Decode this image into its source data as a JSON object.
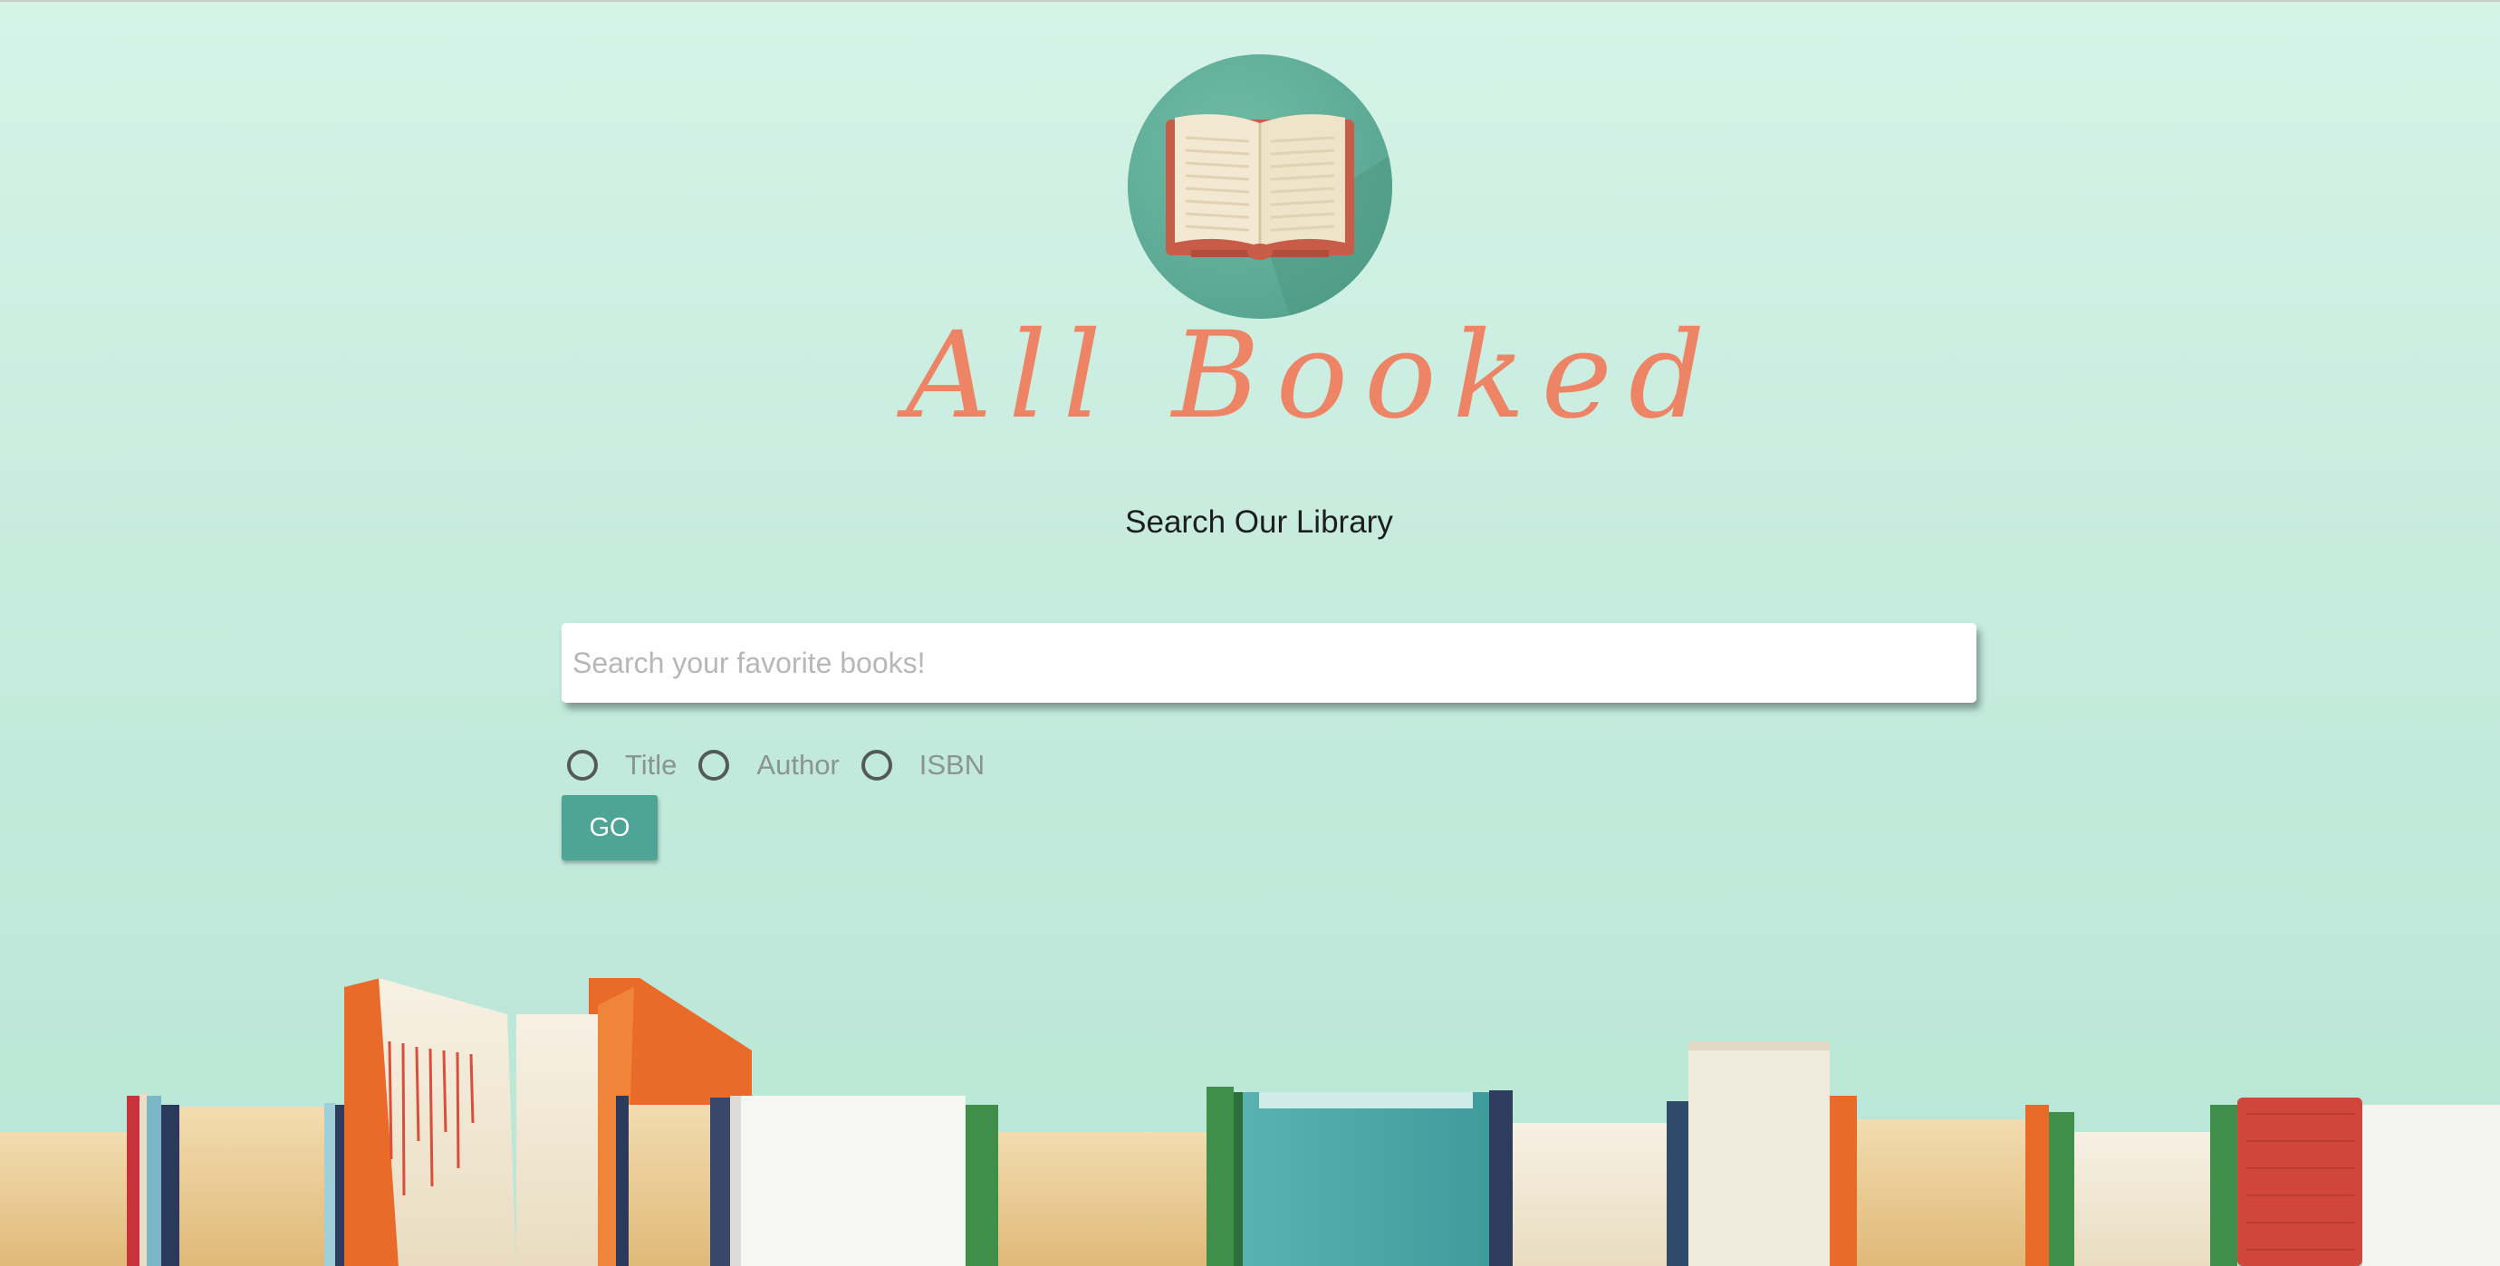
{
  "brand": {
    "name": "All Booked",
    "logo_icon": "open-book-icon",
    "colors": {
      "logo_circle": "#5aa893",
      "brand_text": "#ee8466",
      "accent_button": "#4ea596",
      "background": "#c6ecde"
    }
  },
  "header": {
    "subtitle": "Search Our Library"
  },
  "search": {
    "placeholder": "Search your favorite books!",
    "value": ""
  },
  "search_options": [
    {
      "label": "Title",
      "selected": false
    },
    {
      "label": "Author",
      "selected": false
    },
    {
      "label": "ISBN",
      "selected": false
    }
  ],
  "actions": {
    "go_label": "GO"
  },
  "decoration": {
    "background_image": "row-of-books-on-shelf"
  }
}
